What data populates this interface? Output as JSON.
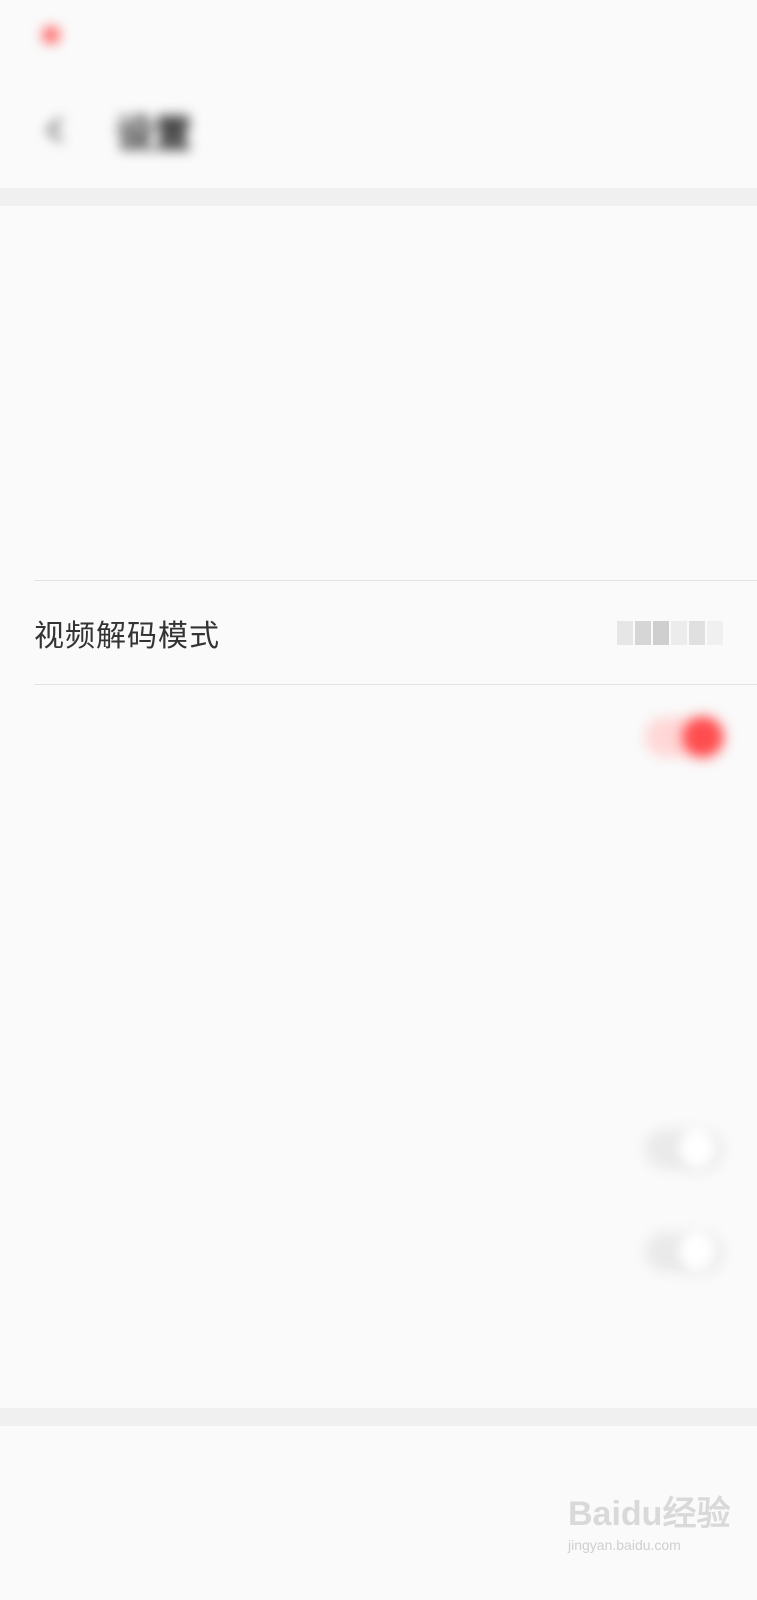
{
  "status_bar": {
    "left_text": "",
    "right_text": ""
  },
  "header": {
    "title": "设置"
  },
  "sections": [
    {
      "label": ""
    },
    {
      "label": ""
    }
  ],
  "rows": [
    {
      "label": "",
      "value": ""
    },
    {
      "label": "",
      "value": ""
    },
    {
      "label": ""
    },
    {
      "label": "视频解码模式",
      "value": ""
    },
    {
      "label": "",
      "toggle_on": true
    },
    {
      "label": "",
      "value": ""
    },
    {
      "label": "",
      "value": ""
    },
    {
      "label": ""
    },
    {
      "label": "",
      "toggle_on": false
    },
    {
      "label": "",
      "toggle_on": false
    },
    {
      "label": ""
    },
    {
      "label": ""
    }
  ],
  "watermark": {
    "logo": "Baidu经验",
    "url": "jingyan.baidu.com"
  },
  "colors": {
    "accent": "#ff4d4f"
  }
}
